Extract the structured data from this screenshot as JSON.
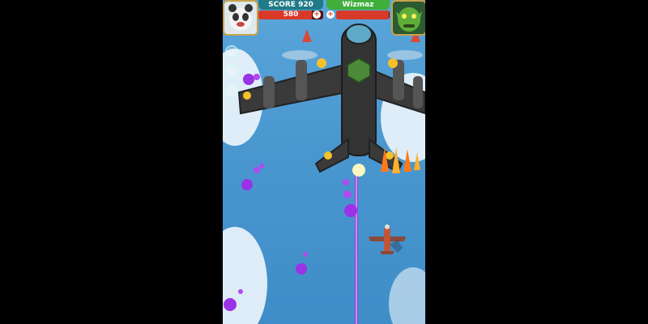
{
  "hud": {
    "score_label": "SCORE 920",
    "player_hp_value": "580",
    "player_hp_fraction": 0.82,
    "boss_name": "Wizmaz",
    "boss_hp_fraction": 0.98
  },
  "icons": {
    "player_avatar": "panda-face-icon",
    "boss_avatar": "green-orc-face-icon",
    "plus": "plus-icon",
    "boss_ship": "bomber-aircraft-icon",
    "player_ship": "fighter-plane-icon"
  },
  "colors": {
    "sky": "#4a97d0",
    "score_bar": "#1f7b86",
    "boss_bar": "#3fae3a",
    "hp_fill": "#d83a2a",
    "laser": "#b34cff",
    "enemy_projectile": "#9a32e6"
  }
}
